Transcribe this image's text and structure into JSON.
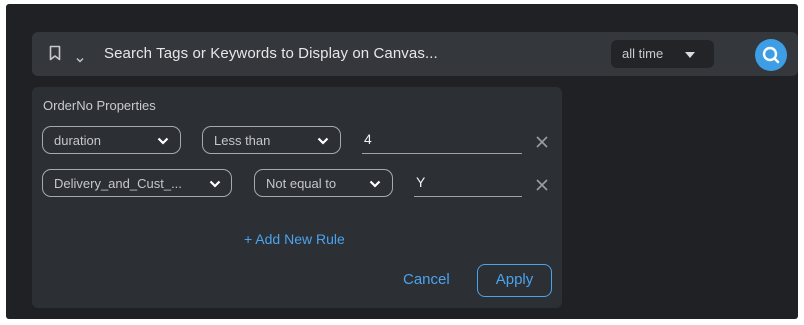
{
  "search": {
    "placeholder": "Search Tags or Keywords to Display on Canvas...",
    "time_filter": "all time"
  },
  "panel": {
    "title": "OrderNo Properties",
    "rules": [
      {
        "field": "duration",
        "operator": "Less than",
        "value": "4"
      },
      {
        "field": "Delivery_and_Cust_...",
        "operator": "Not equal to",
        "value": "Y"
      }
    ],
    "add_rule_label": "+ Add New Rule",
    "cancel_label": "Cancel",
    "apply_label": "Apply"
  },
  "colors": {
    "background": "#1f2124",
    "panel": "#2c2f33",
    "accent": "#4aa3f0",
    "search_button": "#3d9ee6"
  },
  "icons": [
    "bookmark-icon",
    "chevron-down-icon",
    "caret-down-icon",
    "search-icon",
    "close-icon"
  ]
}
